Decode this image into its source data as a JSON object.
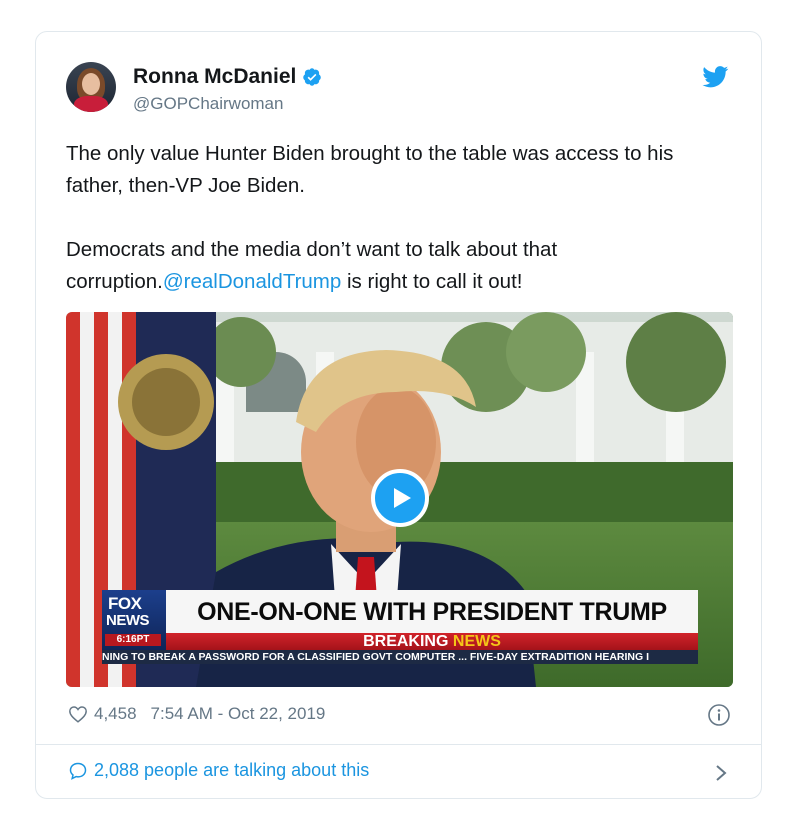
{
  "author": {
    "name": "Ronna McDaniel",
    "handle": "@GOPChairwoman",
    "verified": true
  },
  "tweet": {
    "para1": "The only value Hunter Biden brought to the table was access to his father, then-VP Joe Biden.",
    "para2_before": "Democrats and the media don’t want to talk about that corruption.",
    "mention": "@realDonaldTrump",
    "para2_after": " is right to call it out!"
  },
  "video": {
    "chyron_title": "ONE-ON-ONE WITH PRESIDENT TRUMP",
    "breaking": "BREAKING",
    "news": "NEWS",
    "logo_line1": "FOX",
    "logo_line2": "NEWS",
    "logo_time": "6:16PT",
    "ticker": "NING TO BREAK A PASSWORD FOR A CLASSIFIED GOVT COMPUTER ... FIVE-DAY EXTRADITION HEARING I"
  },
  "meta": {
    "likes": "4,458",
    "timestamp": "7:54 AM - Oct 22, 2019"
  },
  "footer": {
    "talking": "2,088 people are talking about this"
  },
  "colors": {
    "accent": "#1da1f2",
    "link": "#1b95e0",
    "muted": "#657786"
  },
  "icons": [
    "twitter-bird-icon",
    "verified-badge-icon",
    "play-icon",
    "heart-icon",
    "info-icon",
    "speech-bubble-icon",
    "chevron-right-icon"
  ]
}
